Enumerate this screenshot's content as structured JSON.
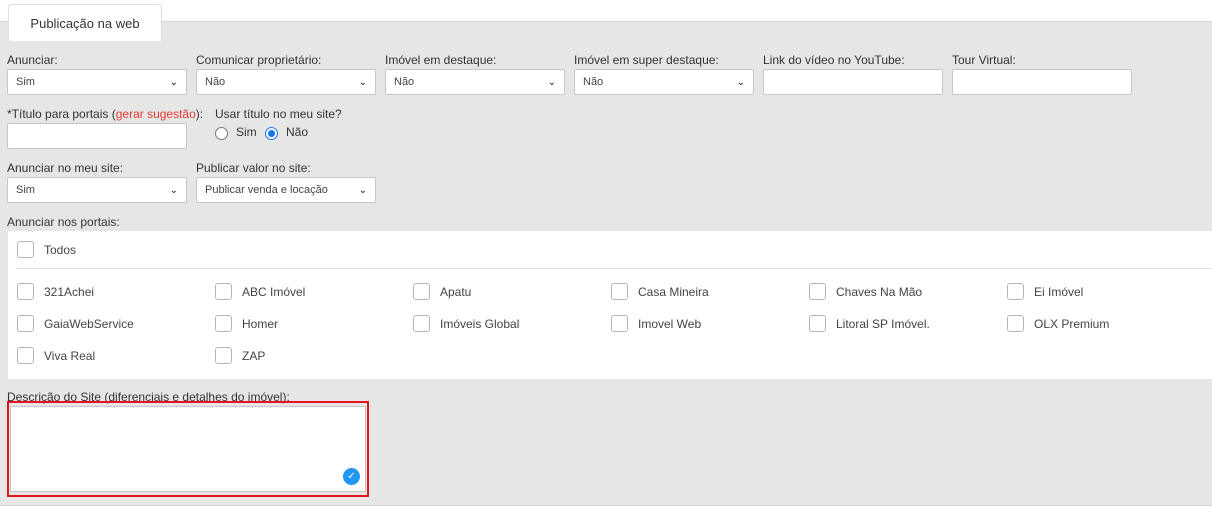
{
  "tab": {
    "title": "Publicação na web"
  },
  "row1": {
    "anunciar": {
      "label": "Anunciar:",
      "value": "Sim"
    },
    "comunicar": {
      "label": "Comunicar proprietário:",
      "value": "Não"
    },
    "destaque": {
      "label": "Imóvel em destaque:",
      "value": "Não"
    },
    "super_destaque": {
      "label": "Imóvel em super destaque:",
      "value": "Não"
    },
    "youtube": {
      "label": "Link do vídeo no YouTube:",
      "value": ""
    },
    "tour": {
      "label": "Tour Virtual:",
      "value": ""
    }
  },
  "row2": {
    "titulo": {
      "label_prefix": "*Título para portais (",
      "link": "gerar sugestão",
      "label_suffix": "):",
      "value": ""
    },
    "usar_titulo": {
      "label": "Usar título no meu site?",
      "option_sim": "Sim",
      "option_nao": "Não",
      "selected": "Não"
    }
  },
  "row3": {
    "anunciar_site": {
      "label": "Anunciar no meu site:",
      "value": "Sim"
    },
    "publicar_valor": {
      "label": "Publicar valor no site:",
      "value": "Publicar venda e locação"
    }
  },
  "portais": {
    "label": "Anunciar nos portais:",
    "all_label": "Todos",
    "items": [
      "321Achei",
      "ABC Imóvel",
      "Apatu",
      "Casa Mineira",
      "Chaves Na Mão",
      "Ei Imóvel",
      "GaiaWebService",
      "Homer",
      "Imóveis Global",
      "Imovel Web",
      "Litoral SP Imóvel.",
      "OLX Premium",
      "Viva Real",
      "ZAP"
    ]
  },
  "descricao": {
    "label": "Descrição do Site (diferenciais e detalhes do imóvel):",
    "value": ""
  },
  "colors": {
    "accent": "#1a73e8",
    "link": "#e53935",
    "highlight": "#e8141b",
    "panel": "#e6e6e6"
  },
  "icons": {
    "dropdown": "chevron-down-icon",
    "badge": "checkmark-icon"
  }
}
